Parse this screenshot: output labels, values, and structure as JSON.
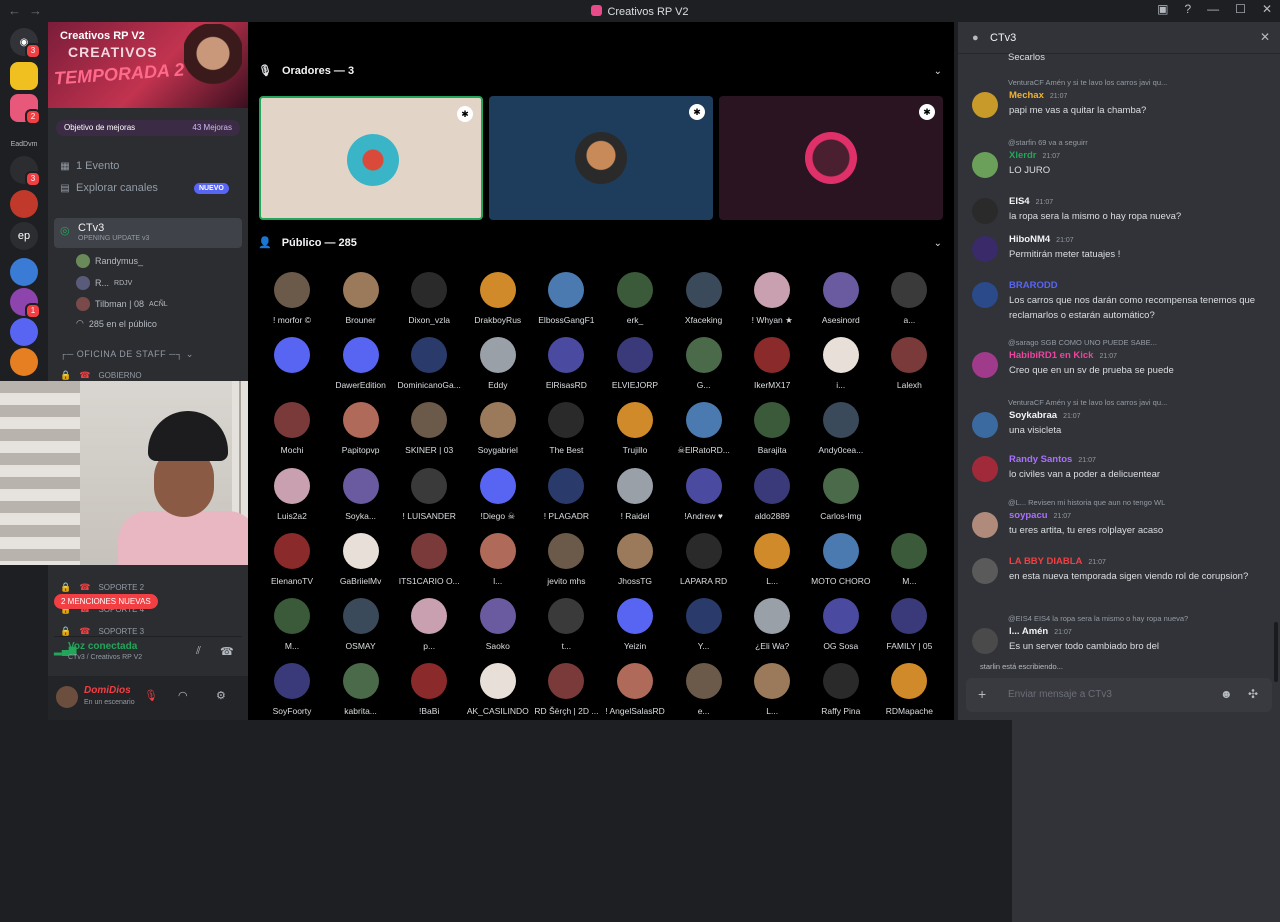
{
  "window": {
    "title": "Creativos RP V2"
  },
  "guild_badges": [
    "3",
    "2",
    "3",
    "1"
  ],
  "guild_labels": {
    "ep": "ep",
    "edd": "EadDvm"
  },
  "server": {
    "name": "Creativos RP V2",
    "banner_line1": "CREATIVOS",
    "banner_line2": "TEMPORADA 2",
    "boost_label": "Objetivo de mejoras",
    "boost_count": "43 Mejoras",
    "events": "1 Evento",
    "explore": "Explorar canales",
    "new_badge": "NUEVO"
  },
  "voice_channel": {
    "name": "CTv3",
    "status": "OPENING UPDATE v3",
    "users": [
      "Randymus_",
      "R...",
      "Tilbman | 08"
    ],
    "user2_tag": "RDJV",
    "user3_tag": "ACÑL",
    "public_count": "285 en el público"
  },
  "staff_category": "OFICINA DE STAFF",
  "locked_channels": [
    "GOBIERNO",
    "SOPORTE 2",
    "SOPORTE 4",
    "SOPORTE 3"
  ],
  "mentions_badge": "2 MENCIONES NUEVAS",
  "voice_panel": {
    "status": "Voz conectada",
    "location": "CTv3 / Creativos RP V2"
  },
  "user_panel": {
    "name": "DomiDios",
    "status": "En un escenario"
  },
  "main": {
    "speakers_header": "Oradores — 3",
    "public_header": "Público — 285",
    "audience": [
      [
        "! morfor ©",
        "Brouner",
        "Dixon_vzla",
        "DrakboyRus",
        "ElbossGangF1",
        "erk_",
        "Xfaceking",
        "! Whyan ★",
        "Asesinord",
        "a..."
      ],
      [
        "",
        "DawerEdition",
        "DominicanoGa...",
        "Eddy",
        "ElRisasRD",
        "ELVIEJORP",
        "G...",
        "IkerMX17",
        "i...",
        "Lalexh"
      ],
      [
        "Mochi",
        "Papitopvp",
        "SKINER | 03",
        "Soygabriel",
        "The Best",
        "Trujillo",
        "☠ElRatoRD...",
        "Barajita",
        "Andy0cea..."
      ],
      [
        "Luis2a2",
        "Soyka...",
        "! LUISANDER",
        "!Diego ☠",
        "! PLAGADR",
        "! Raidel",
        "!Andrew ♥",
        "aldo2889",
        "Carlos-lmg"
      ],
      [
        "ElenanoTV",
        "GaBriielMv",
        "ITS1CARIO O...",
        "l...",
        "jevito mhs",
        "JhossTG",
        "LAPARA RD",
        "L...",
        "MOTO CHORO",
        "M..."
      ],
      [
        "M...",
        "OSMAY",
        "p...",
        "Saoko",
        "t...",
        "Yeizin",
        "Y...",
        "¿Eli Wa?",
        "OG Sosa",
        "FAMILY | 05"
      ],
      [
        "SoyFoorty",
        "kabrita...",
        "!BaBi",
        "AK_CASILINDO",
        "RD Šërçh | 2D ...",
        "! AngelSalasRD",
        "e...",
        "L...",
        "Raffy Pina",
        "RDMapache"
      ]
    ]
  },
  "chat": {
    "channel": "CTv3",
    "top_text": "Secarlos",
    "messages": [
      {
        "reply": "VenturaCF   Amén  y si te lavo los carros javi qu...",
        "name": "Mechax",
        "time": "21:07",
        "text": "papi me vas a quitar la chamba?",
        "color": "#f0b232"
      },
      {
        "reply": "@starfin  69  va a seguirr",
        "name": "Xlerdr",
        "time": "21:07",
        "text": "LO JURO",
        "color": "#23a55a"
      },
      {
        "reply": "",
        "name": "EIS4",
        "time": "21:07",
        "text": "la ropa sera la mismo o hay ropa nueva?",
        "color": "#f2f3f5"
      },
      {
        "reply": "",
        "name": "HiboNM4",
        "time": "21:07",
        "text": "Permitirán meter tatuajes !",
        "color": "#f2f3f5"
      },
      {
        "reply": "",
        "name": "BRARODD",
        "time": "",
        "text": "Los carros que nos darán como recompensa tenemos que reclamarlos o estarán automático?",
        "color": "#5865f2"
      },
      {
        "reply": "@sarago  SGB  COMO UNO PUEDE SABE...",
        "name": "HabibiRD1 en Kick",
        "time": "21:07",
        "text": "Creo que en un sv de prueba se puede",
        "color": "#eb459e"
      },
      {
        "reply": "VenturaCF   Amén  y si te lavo los carros javi qu...",
        "name": "Soykabraa",
        "time": "21:07",
        "text": "una visicleta",
        "color": "#f2f3f5"
      },
      {
        "reply": "",
        "name": "Randy Santos",
        "time": "21:07",
        "text": "lo civiles van a poder a delicuentear",
        "color": "#a970ff"
      },
      {
        "reply": "@L...  Revisen mi historia que aun no tengo WL",
        "name": "soypacu",
        "time": "21:07",
        "text": "tu eres artita, tu eres rolplayer acaso",
        "color": "#a970ff"
      },
      {
        "reply": "",
        "name": "LA BBY DIABLA",
        "time": "21:07",
        "text": "en esta nueva temporada sigen viendo rol de corupsion?",
        "color": "#f23f43"
      },
      {
        "reply": "@EIS4  EIS4  la ropa sera la mismo o hay ropa nueva?",
        "name": "l...  Amén",
        "time": "21:07",
        "text": "Es un server todo cambiado bro del",
        "color": "#f2f3f5"
      }
    ],
    "typing": "starlin está escribiendo...",
    "placeholder": "Enviar mensaje a CTv3"
  }
}
